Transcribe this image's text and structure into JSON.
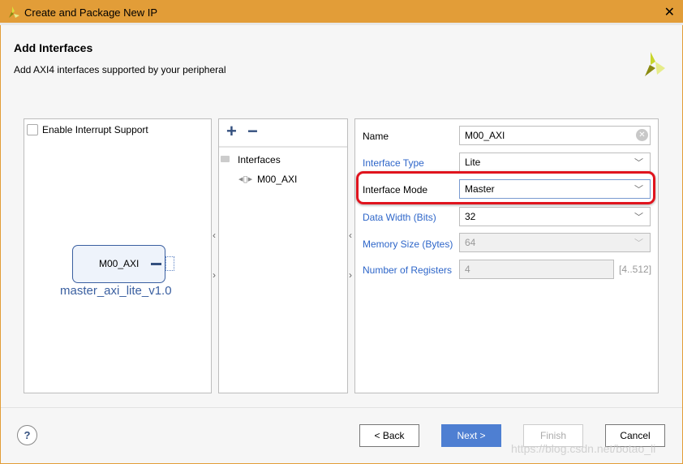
{
  "window": {
    "title": "Create and Package New IP",
    "close_icon": "close-icon"
  },
  "header": {
    "title": "Add Interfaces",
    "subtitle": "Add AXI4 interfaces supported by your peripheral"
  },
  "left": {
    "interrupt_label": "Enable Interrupt Support",
    "interrupt_checked": false,
    "block_port": "M00_AXI",
    "block_name": "master_axi_lite_v1.0"
  },
  "tree": {
    "add": "+",
    "remove": "−",
    "root": "Interfaces",
    "items": [
      "M00_AXI"
    ]
  },
  "form": {
    "name_label": "Name",
    "name_value": "M00_AXI",
    "type_label": "Interface Type",
    "type_value": "Lite",
    "mode_label": "Interface Mode",
    "mode_value": "Master",
    "width_label": "Data Width (Bits)",
    "width_value": "32",
    "mem_label": "Memory Size (Bytes)",
    "mem_value": "64",
    "regs_label": "Number of Registers",
    "regs_value": "4",
    "regs_range": "[4..512]"
  },
  "footer": {
    "help": "?",
    "back": "< Back",
    "next": "Next >",
    "finish": "Finish",
    "cancel": "Cancel"
  },
  "watermark": "https://blog.csdn.net/botao_li",
  "colors": {
    "titlebar": "#e29d38",
    "accent": "#4e7fd2",
    "highlight": "#e0141e",
    "label_link": "#2e66c9"
  }
}
